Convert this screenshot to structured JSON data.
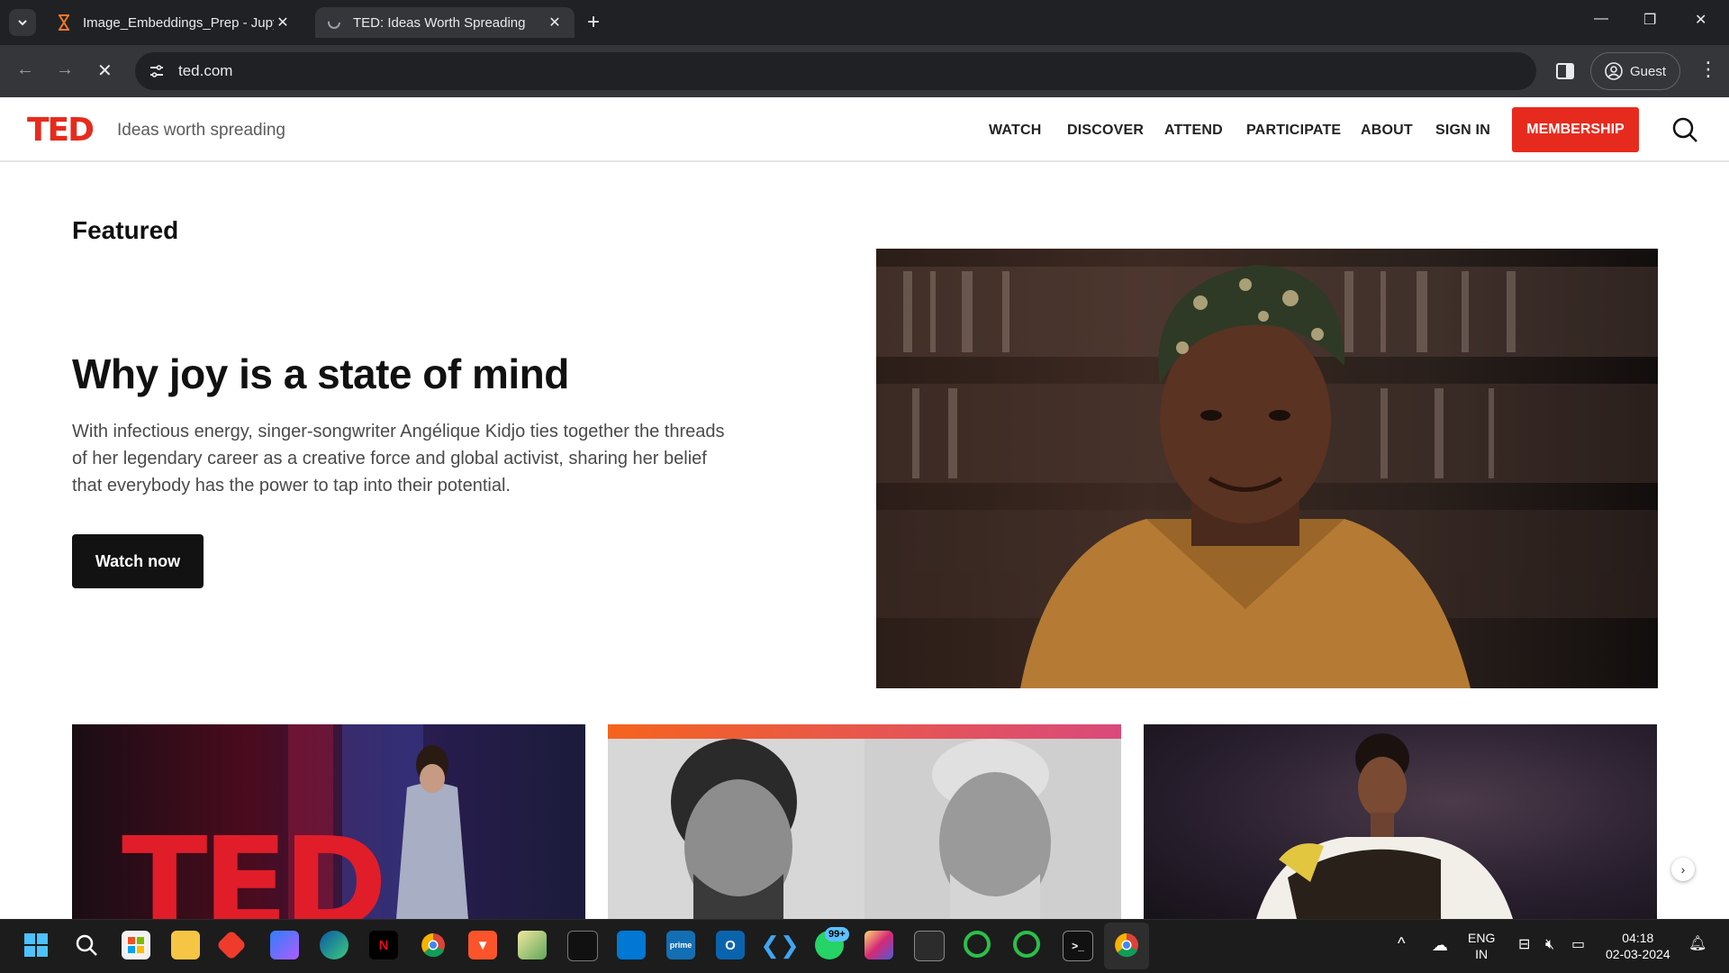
{
  "browser": {
    "tabs": [
      {
        "title": "Image_Embeddings_Prep - Jupyter",
        "active": false
      },
      {
        "title": "TED: Ideas Worth Spreading",
        "active": true
      }
    ],
    "new_tab_label": "+",
    "url": "ted.com",
    "profile_label": "Guest"
  },
  "site": {
    "logo_text": "TED",
    "tagline": "Ideas worth spreading",
    "nav": [
      "WATCH",
      "DISCOVER",
      "ATTEND",
      "PARTICIPATE",
      "ABOUT",
      "SIGN IN"
    ],
    "membership_label": "MEMBERSHIP",
    "accent_color": "#e62b1e"
  },
  "featured": {
    "section_label": "Featured",
    "title": "Why joy is a state of mind",
    "description": "With infectious energy, singer-songwriter Angélique Kidjo ties together the threads of her legendary career as a creative force and global activist, sharing her belief that everybody has the power to tap into their potential.",
    "cta_label": "Watch now"
  },
  "cards": {
    "card1_stage_letters": "TED",
    "next_arrow": "›"
  },
  "taskbar": {
    "apps": [
      "start-icon",
      "search-icon",
      "store-icon",
      "file-explorer-icon",
      "anydesk-icon",
      "copilot-icon",
      "edge-icon",
      "netflix-icon",
      "chrome-icon",
      "brave-icon",
      "image-viewer-icon",
      "terminal-icon",
      "windows-store-icon",
      "prime-video-icon",
      "outlook-icon",
      "vscode-icon",
      "whatsapp-icon",
      "instagram-icon",
      "console-icon",
      "ring-app-icon",
      "ring-app-2-icon",
      "terminal-2-icon",
      "chrome-active-icon"
    ],
    "notification_badge": "99+",
    "language_line1": "ENG",
    "language_line2": "IN",
    "time": "04:18",
    "date": "02-03-2024"
  }
}
